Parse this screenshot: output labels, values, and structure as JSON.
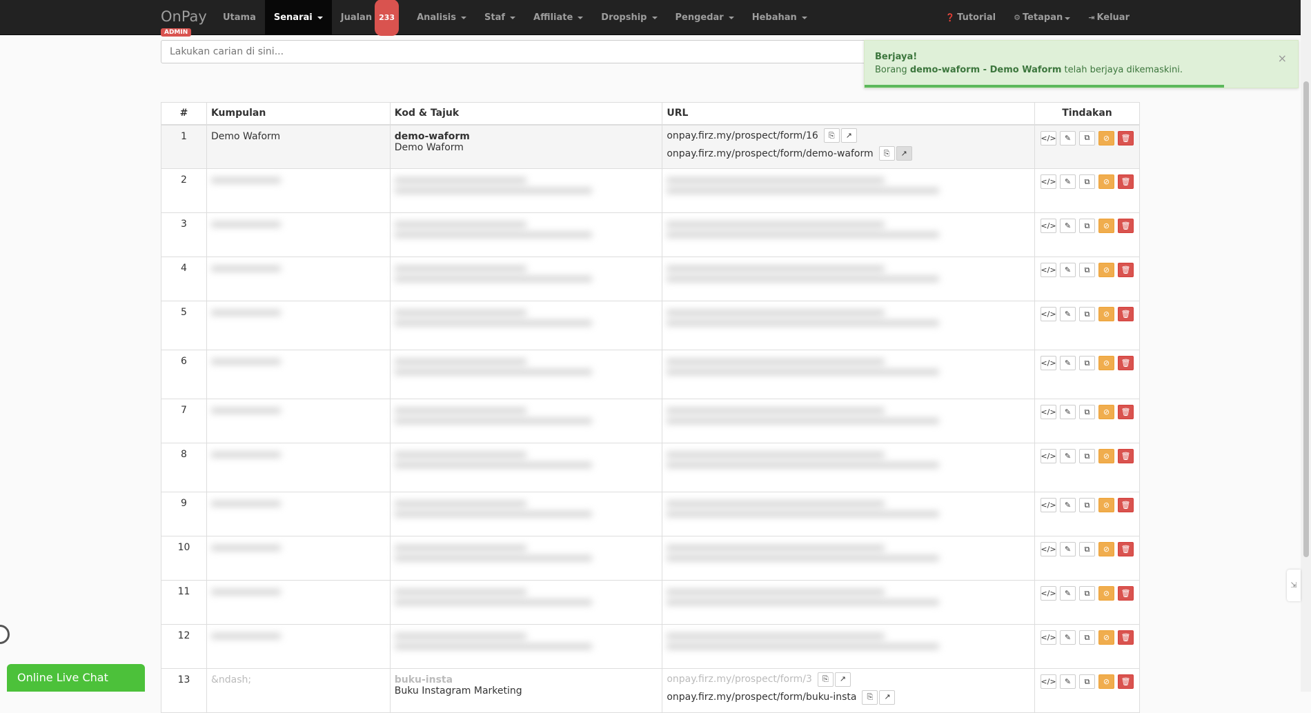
{
  "nav": {
    "brand": "OnPay",
    "role_badge": "ADMIN",
    "items": [
      {
        "label": "Utama"
      },
      {
        "label": "Senarai",
        "active": true,
        "dropdown": true
      },
      {
        "label": "Jualan",
        "badge": "233"
      },
      {
        "label": "Analisis",
        "dropdown": true
      },
      {
        "label": "Staf",
        "dropdown": true
      },
      {
        "label": "Affiliate",
        "dropdown": true
      },
      {
        "label": "Dropship",
        "dropdown": true
      },
      {
        "label": "Pengedar",
        "dropdown": true
      },
      {
        "label": "Hebahan",
        "dropdown": true
      }
    ],
    "right": [
      {
        "label": "Tutorial",
        "icon": "question-circle-icon"
      },
      {
        "label": "Tetapan",
        "icon": "gears-icon"
      },
      {
        "label": "Keluar",
        "icon": "sign-out-icon"
      }
    ]
  },
  "search": {
    "placeholder": "Lakukan carian di sini..."
  },
  "toast": {
    "title": "Berjaya!",
    "prefix": "Borang ",
    "bold": "demo-waform - Demo Waform",
    "suffix": " telah berjaya dikemaskini.",
    "close": "×",
    "progress": 0.83
  },
  "table": {
    "headers": [
      "#",
      "Kumpulan",
      "Kod & Tajuk",
      "URL",
      "Tindakan"
    ],
    "rows": [
      {
        "num": "1",
        "group": "Demo Waform",
        "code": "demo-waform",
        "title": "Demo Waform",
        "url1": "onpay.firz.my/prospect/form/16",
        "url2": "onpay.firz.my/prospect/form/demo-waform"
      },
      {
        "num": "2",
        "blurred": true
      },
      {
        "num": "3",
        "blurred": true
      },
      {
        "num": "4",
        "blurred": true
      },
      {
        "num": "5",
        "blurred": true
      },
      {
        "num": "6",
        "blurred": true
      },
      {
        "num": "7",
        "blurred": true
      },
      {
        "num": "8",
        "blurred": true
      },
      {
        "num": "9",
        "blurred": true
      },
      {
        "num": "10",
        "blurred": true
      },
      {
        "num": "11",
        "blurred": true
      },
      {
        "num": "12",
        "blurred": true
      },
      {
        "num": "13",
        "group": "&ndash;",
        "code": "buku-insta",
        "title": "Buku Instagram Marketing",
        "url1": "onpay.firz.my/prospect/form/3",
        "url2": "onpay.firz.my/prospect/form/buku-insta"
      }
    ]
  },
  "chat": {
    "label": "Online Live Chat"
  },
  "colors": {
    "navbar": "#222222",
    "success": "#5cb85c",
    "warning": "#f0ad4e",
    "danger": "#d9534f",
    "chat": "#4cc13a"
  }
}
